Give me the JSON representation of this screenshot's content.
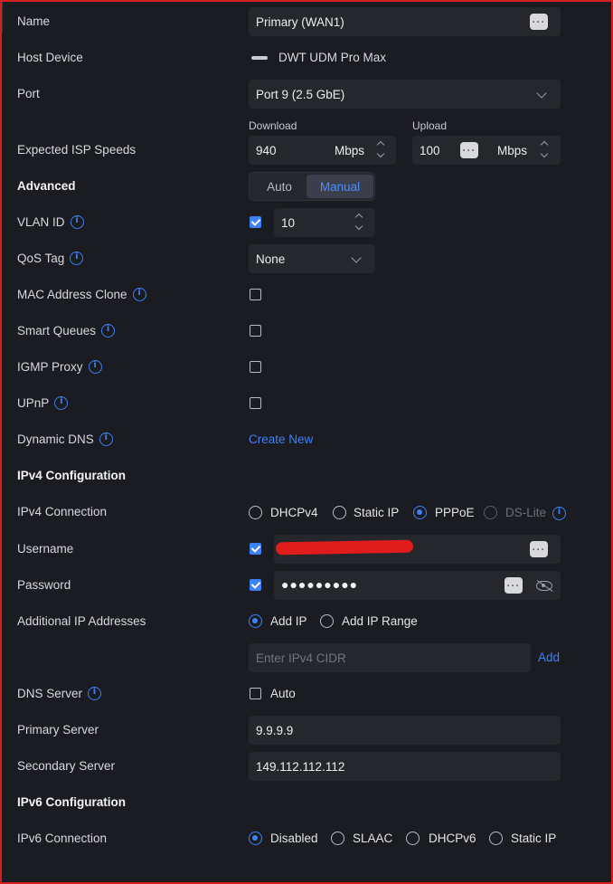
{
  "name": {
    "label": "Name",
    "value": "Primary (WAN1)"
  },
  "host_device": {
    "label": "Host Device",
    "value": "DWT UDM Pro Max"
  },
  "port": {
    "label": "Port",
    "value": "Port 9 (2.5 GbE)"
  },
  "isp_speeds": {
    "label": "Expected ISP Speeds",
    "download_label": "Download",
    "download_value": "940",
    "download_unit": "Mbps",
    "upload_label": "Upload",
    "upload_value": "100",
    "upload_unit": "Mbps"
  },
  "advanced": {
    "label": "Advanced",
    "options": [
      "Auto",
      "Manual"
    ],
    "selected": "Manual"
  },
  "vlan": {
    "label": "VLAN ID",
    "checked": true,
    "value": "10"
  },
  "qos": {
    "label": "QoS Tag",
    "value": "None"
  },
  "mac_clone": {
    "label": "MAC Address Clone",
    "checked": false
  },
  "smart_queues": {
    "label": "Smart Queues",
    "checked": false
  },
  "igmp_proxy": {
    "label": "IGMP Proxy",
    "checked": false
  },
  "upnp": {
    "label": "UPnP",
    "checked": false
  },
  "dynamic_dns": {
    "label": "Dynamic DNS",
    "link": "Create New"
  },
  "ipv4_section": "IPv4 Configuration",
  "ipv4_connection": {
    "label": "IPv4 Connection",
    "options": [
      "DHCPv4",
      "Static IP",
      "PPPoE",
      "DS-Lite"
    ],
    "selected": "PPPoE",
    "disabled": [
      "DS-Lite"
    ]
  },
  "username": {
    "label": "Username",
    "checked": true
  },
  "password": {
    "label": "Password",
    "checked": true,
    "value": "●●●●●●●●●"
  },
  "additional_ip": {
    "label": "Additional IP Addresses",
    "options": [
      "Add IP",
      "Add IP Range"
    ],
    "selected": "Add IP",
    "placeholder": "Enter IPv4 CIDR",
    "add_label": "Add"
  },
  "dns_server": {
    "label": "DNS Server",
    "auto_label": "Auto",
    "checked": false
  },
  "primary_server": {
    "label": "Primary Server",
    "value": "9.9.9.9"
  },
  "secondary_server": {
    "label": "Secondary Server",
    "value": "149.112.112.112"
  },
  "ipv6_section": "IPv6 Configuration",
  "ipv6_connection": {
    "label": "IPv6 Connection",
    "options": [
      "Disabled",
      "SLAAC",
      "DHCPv6",
      "Static IP"
    ],
    "selected": "Disabled"
  },
  "colors": {
    "accent": "#3b82f6",
    "background": "#1b1c21",
    "field": "#25272d",
    "border": "#d81f1f",
    "redaction": "#e11c1c"
  },
  "icons": [
    "info-icon",
    "more-dots-icon",
    "chevron-down-icon",
    "spinner-icon",
    "eye-off-icon",
    "device-icon"
  ]
}
